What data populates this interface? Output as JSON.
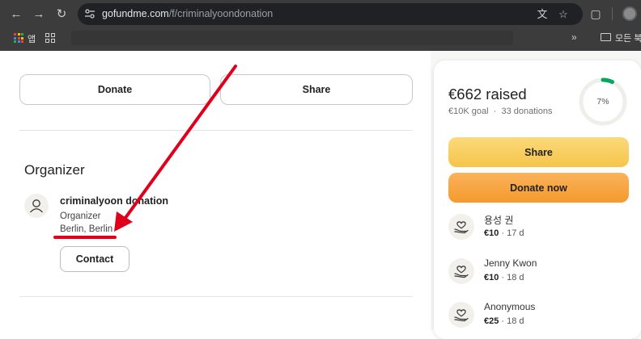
{
  "browser": {
    "url_domain": "gofundme.com",
    "url_path": "/f/criminalyoondonation",
    "apps_label": "앱",
    "bookmarks_more": "»",
    "bookmarks_folder": "모든 북"
  },
  "actions": {
    "donate_label": "Donate",
    "share_label": "Share"
  },
  "organizer": {
    "heading": "Organizer",
    "name": "criminalyoon donation",
    "role": "Organizer",
    "location": "Berlin, Berlin",
    "contact_label": "Contact"
  },
  "card": {
    "raised": "€662 raised",
    "goal": "€10K goal",
    "separator": "·",
    "donations_count": "33 donations",
    "progress_label": "7%",
    "progress_fraction": 0.07,
    "share_label": "Share",
    "donate_now_label": "Donate now"
  },
  "donations": [
    {
      "name": "용성 권",
      "amount": "€10",
      "age": "17 d"
    },
    {
      "name": "Jenny Kwon",
      "amount": "€10",
      "age": "18 d"
    },
    {
      "name": "Anonymous",
      "amount": "€25",
      "age": "18 d"
    }
  ],
  "colors": {
    "progress_green": "#02a95c",
    "annotation_red": "#e0001b",
    "share_yellow": "#f6c54a",
    "donate_orange": "#f49a2e"
  }
}
